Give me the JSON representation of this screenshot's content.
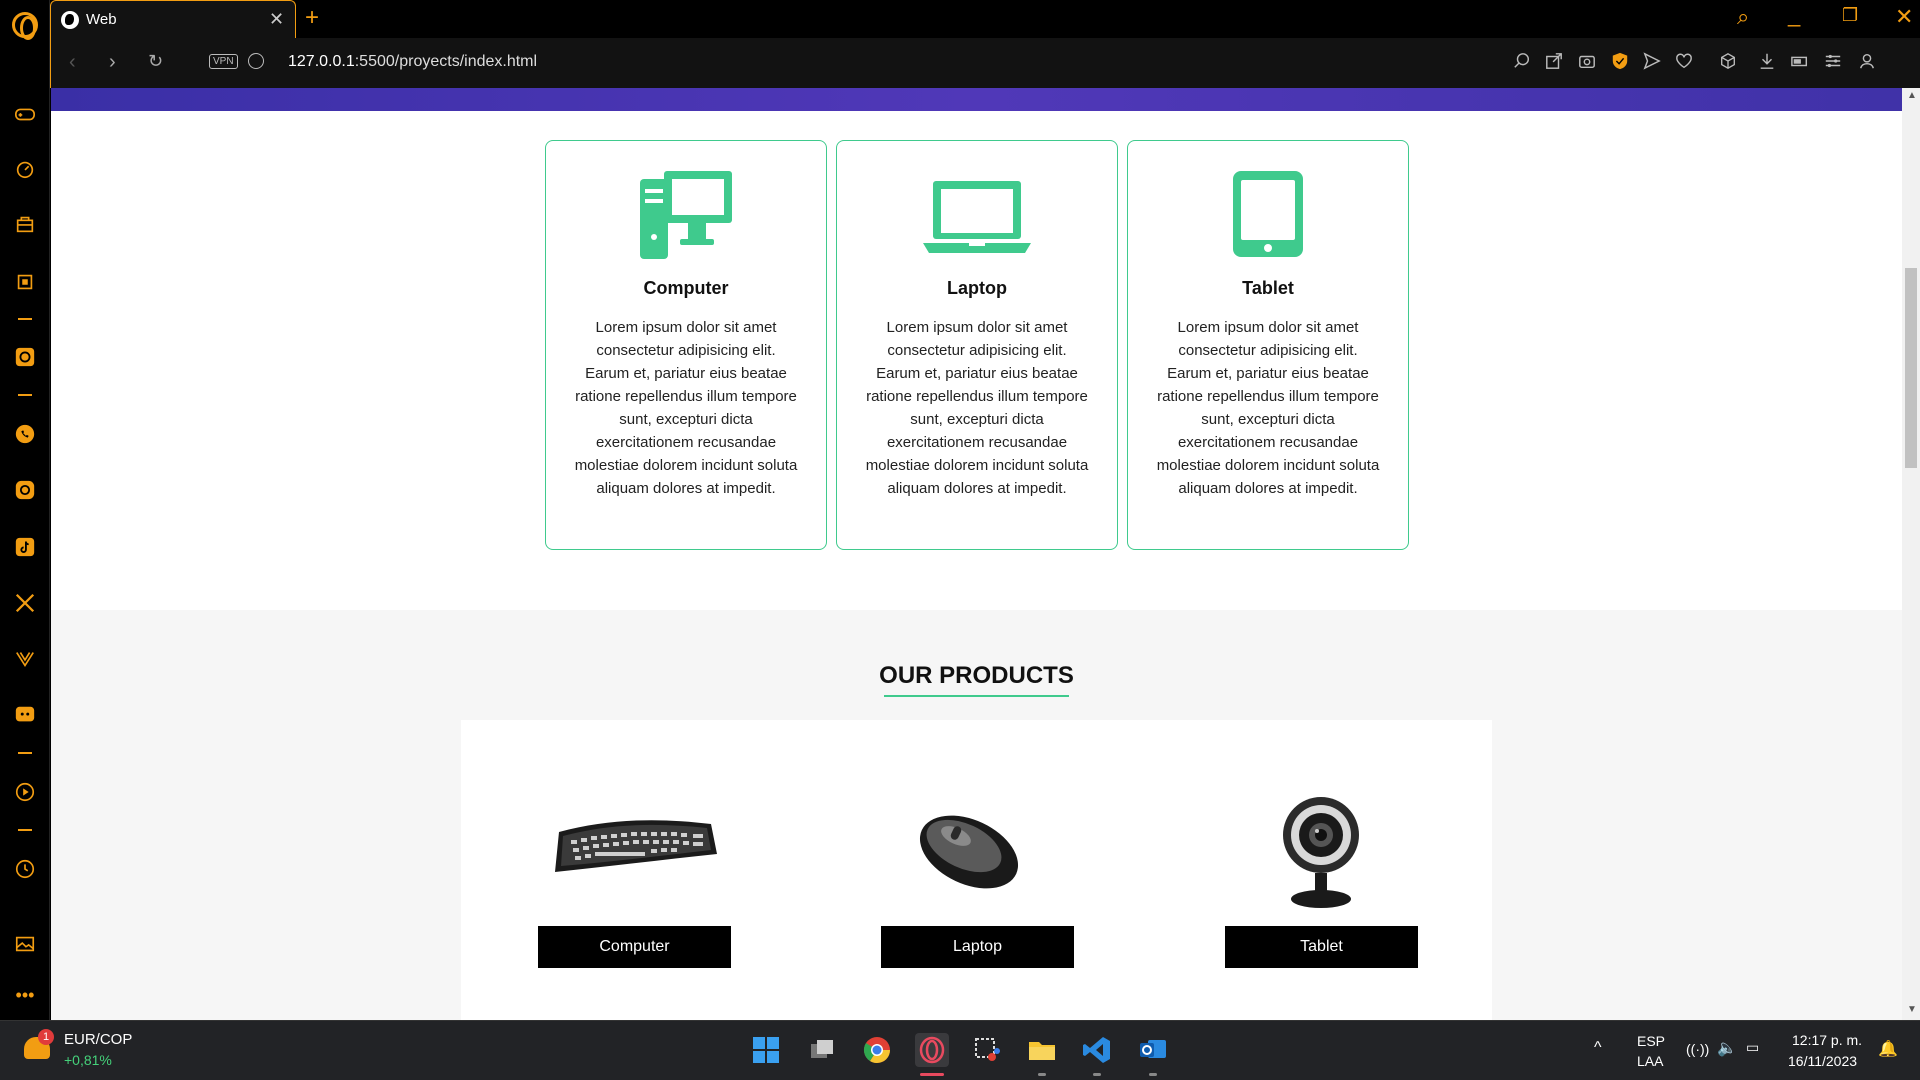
{
  "browser": {
    "tab_title": "Web",
    "url_host": "127.0.0.1",
    "url_rest": ":5500/proyects/index.html",
    "vpn_label": "VPN",
    "accent_color": "#f29d12"
  },
  "cards": [
    {
      "icon": "desktop-computer-icon",
      "title": "Computer",
      "text": "Lorem ipsum dolor sit amet consectetur adipisicing elit. Earum et, pariatur eius beatae ratione repellendus illum tempore sunt, excepturi dicta exercitationem recusandae molestiae dolorem incidunt soluta aliquam dolores at impedit."
    },
    {
      "icon": "laptop-icon",
      "title": "Laptop",
      "text": "Lorem ipsum dolor sit amet consectetur adipisicing elit. Earum et, pariatur eius beatae ratione repellendus illum tempore sunt, excepturi dicta exercitationem recusandae molestiae dolorem incidunt soluta aliquam dolores at impedit."
    },
    {
      "icon": "tablet-icon",
      "title": "Tablet",
      "text": "Lorem ipsum dolor sit amet consectetur adipisicing elit. Earum et, pariatur eius beatae ratione repellendus illum tempore sunt, excepturi dicta exercitationem recusandae molestiae dolorem incidunt soluta aliquam dolores at impedit."
    }
  ],
  "card_accent_color": "#3fca8d",
  "products": {
    "title": "OUR PRODUCTS",
    "items": [
      {
        "image": "keyboard-image",
        "button": "Computer"
      },
      {
        "image": "mouse-image",
        "button": "Laptop"
      },
      {
        "image": "webcam-image",
        "button": "Tablet"
      }
    ]
  },
  "taskbar": {
    "ticker_pair": "EUR/COP",
    "ticker_change": "+0,81%",
    "notification_count": "1",
    "language": "ESP",
    "layout": "LAA",
    "time": "12:17 p. m.",
    "date": "16/11/2023"
  }
}
